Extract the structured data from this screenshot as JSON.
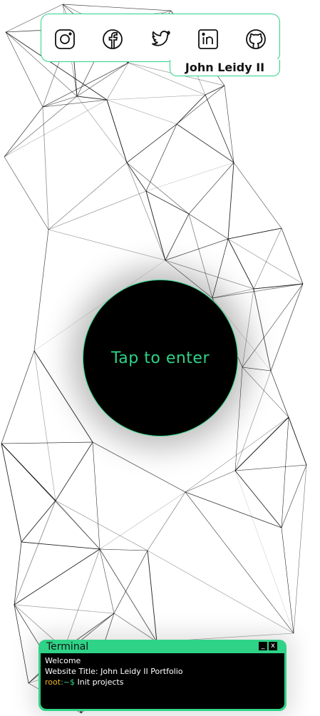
{
  "header": {
    "name": "John Leidy II"
  },
  "social": [
    {
      "icon": "instagram-icon"
    },
    {
      "icon": "facebook-icon"
    },
    {
      "icon": "twitter-icon"
    },
    {
      "icon": "linkedin-icon"
    },
    {
      "icon": "github-icon"
    }
  ],
  "hero": {
    "enter_label": "Tap to enter"
  },
  "terminal": {
    "title": "Terminal",
    "minimize_label": "_",
    "close_label": "x",
    "lines": {
      "welcome": "Welcome",
      "website_title": "Website Title: John Leidy II Portfolio"
    },
    "prompt": {
      "user": "root",
      "path": ":~$",
      "command": "Init projects"
    }
  },
  "colors": {
    "accent": "#2fd387",
    "prompt_user": "#f0b429"
  }
}
